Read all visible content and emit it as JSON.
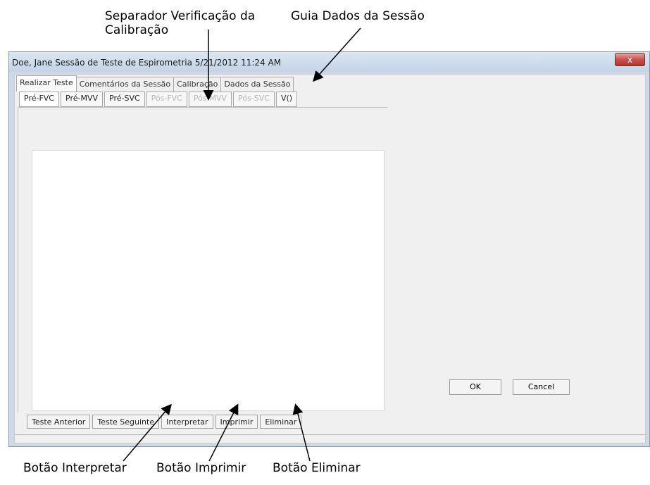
{
  "callouts": {
    "calibration_tab": "Separador Verificação da\nCalibração",
    "session_data_tab": "Guia Dados da Sessão",
    "interpret_button": "Botão Interpretar",
    "print_button": "Botão Imprimir",
    "delete_button": "Botão Eliminar"
  },
  "window": {
    "title": "Doe, Jane Sessão de Teste de Espirometria 5/21/2012 11:24 AM",
    "close_label": "x"
  },
  "tabs": [
    {
      "label": "Realizar Teste",
      "active": true
    },
    {
      "label": "Comentários da Sessão",
      "active": false
    },
    {
      "label": "Calibração",
      "active": false
    },
    {
      "label": "Dados da Sessão",
      "active": false
    }
  ],
  "subtabs": [
    {
      "label": "Pré-FVC",
      "disabled": false
    },
    {
      "label": "Pré-MVV",
      "disabled": false
    },
    {
      "label": "Pré-SVC",
      "disabled": false
    },
    {
      "label": "Pós-FVC",
      "disabled": true
    },
    {
      "label": "Pós-MVV",
      "disabled": true
    },
    {
      "label": "Pós-SVC",
      "disabled": true
    },
    {
      "label": "V()",
      "disabled": false
    }
  ],
  "bottom_buttons": {
    "previous": "Teste Anterior",
    "next": "Teste Seguinte",
    "interpret": "Interpretar",
    "print": "Imprimir",
    "delete": "Eliminar"
  },
  "dialog_buttons": {
    "ok": "OK",
    "cancel": "Cancel"
  }
}
